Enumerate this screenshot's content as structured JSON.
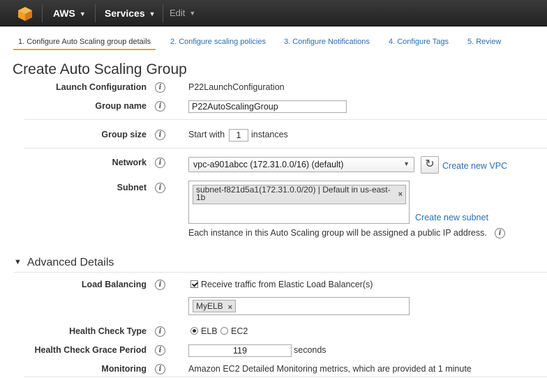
{
  "topbar": {
    "brand": "AWS",
    "services": "Services",
    "edit": "Edit"
  },
  "steps": [
    "1. Configure Auto Scaling group details",
    "2. Configure scaling policies",
    "3. Configure Notifications",
    "4. Configure Tags",
    "5. Review"
  ],
  "title": "Create Auto Scaling Group",
  "form": {
    "launch_config_label": "Launch Configuration",
    "launch_config_value": "P22LaunchConfiguration",
    "group_name_label": "Group name",
    "group_name_value": "P22AutoScalingGroup",
    "group_size_label": "Group size",
    "group_size_prefix": "Start with",
    "group_size_value": "1",
    "group_size_suffix": "instances",
    "network_label": "Network",
    "network_value": "vpc-a901abcc (172.31.0.0/16) (default)",
    "create_vpc": "Create new VPC",
    "subnet_label": "Subnet",
    "subnet_token_line1": "subnet-f821d5a1(172.31.0.0/20) | Default in us-east-",
    "subnet_token_line2": "1b",
    "create_subnet": "Create new subnet",
    "public_ip_note": "Each instance in this Auto Scaling group will be assigned a public IP address."
  },
  "advanced": {
    "heading": "Advanced Details",
    "load_balancing_label": "Load Balancing",
    "elb_checkbox_label": "Receive traffic from Elastic Load Balancer(s)",
    "elb_token": "MyELB",
    "health_check_type_label": "Health Check Type",
    "health_check_options": [
      "ELB",
      "EC2"
    ],
    "grace_period_label": "Health Check Grace Period",
    "grace_period_value": "119",
    "grace_period_unit": "seconds",
    "monitoring_label": "Monitoring",
    "monitoring_text": "Amazon EC2 Detailed Monitoring metrics, which are provided at 1 minute"
  },
  "icons": {
    "info": "info-icon",
    "refresh": "refresh-icon",
    "remove": "close-icon"
  },
  "colors": {
    "link": "#2a6db3",
    "active_underline": "#e7a41f"
  }
}
